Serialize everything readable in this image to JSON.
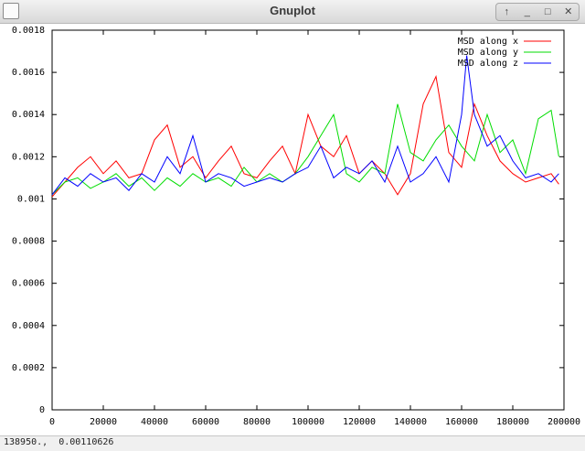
{
  "window": {
    "title": "Gnuplot",
    "buttons": {
      "up": "↑",
      "minimize": "_",
      "maximize": "□",
      "close": "✕"
    }
  },
  "status": {
    "text": "138950.,  0.00110626"
  },
  "chart_data": {
    "type": "line",
    "title": "",
    "xlabel": "",
    "ylabel": "",
    "xlim": [
      0,
      200000
    ],
    "ylim": [
      0,
      0.0018
    ],
    "x_ticks": [
      0,
      20000,
      40000,
      60000,
      80000,
      100000,
      120000,
      140000,
      160000,
      180000,
      200000
    ],
    "y_ticks": [
      0,
      0.0002,
      0.0004,
      0.0006,
      0.0008,
      0.001,
      0.0012,
      0.0014,
      0.0016,
      0.0018
    ],
    "x_tick_labels": [
      "0",
      "20000",
      "40000",
      "60000",
      "80000",
      "100000",
      "120000",
      "140000",
      "160000",
      "180000",
      "200000"
    ],
    "y_tick_labels": [
      "0",
      "0.0002",
      "0.0004",
      "0.0006",
      "0.0008",
      "0.001",
      "0.0012",
      "0.0014",
      "0.0016",
      "0.0018"
    ],
    "grid": false,
    "legend_position": "top-right",
    "series": [
      {
        "name": "MSD along x",
        "color": "#ff0000",
        "x": [
          0,
          5000,
          10000,
          15000,
          20000,
          25000,
          30000,
          35000,
          40000,
          45000,
          50000,
          55000,
          60000,
          65000,
          70000,
          75000,
          80000,
          85000,
          90000,
          95000,
          100000,
          105000,
          110000,
          115000,
          120000,
          125000,
          130000,
          135000,
          140000,
          145000,
          150000,
          155000,
          160000,
          165000,
          170000,
          175000,
          180000,
          185000,
          190000,
          195000,
          198000
        ],
        "y": [
          0.00101,
          0.00108,
          0.00115,
          0.0012,
          0.00112,
          0.00118,
          0.0011,
          0.00112,
          0.00128,
          0.00135,
          0.00115,
          0.0012,
          0.0011,
          0.00118,
          0.00125,
          0.00112,
          0.0011,
          0.00118,
          0.00125,
          0.00112,
          0.0014,
          0.00125,
          0.0012,
          0.0013,
          0.00112,
          0.00118,
          0.00112,
          0.00102,
          0.00112,
          0.00145,
          0.00158,
          0.00122,
          0.00115,
          0.00145,
          0.0013,
          0.00118,
          0.00112,
          0.00108,
          0.0011,
          0.00112,
          0.00107
        ]
      },
      {
        "name": "MSD along y",
        "color": "#00dd00",
        "x": [
          0,
          5000,
          10000,
          15000,
          20000,
          25000,
          30000,
          35000,
          40000,
          45000,
          50000,
          55000,
          60000,
          65000,
          70000,
          75000,
          80000,
          85000,
          90000,
          95000,
          100000,
          105000,
          110000,
          115000,
          120000,
          125000,
          130000,
          135000,
          140000,
          145000,
          150000,
          155000,
          160000,
          165000,
          170000,
          175000,
          180000,
          185000,
          190000,
          195000,
          198000
        ],
        "y": [
          0.00102,
          0.00108,
          0.0011,
          0.00105,
          0.00108,
          0.00112,
          0.00106,
          0.0011,
          0.00104,
          0.0011,
          0.00106,
          0.00112,
          0.00108,
          0.0011,
          0.00106,
          0.00115,
          0.00108,
          0.00112,
          0.00108,
          0.00112,
          0.0012,
          0.0013,
          0.0014,
          0.00112,
          0.00108,
          0.00115,
          0.00112,
          0.00145,
          0.00122,
          0.00118,
          0.00128,
          0.00135,
          0.00125,
          0.00118,
          0.0014,
          0.00122,
          0.00128,
          0.00112,
          0.00138,
          0.00142,
          0.0012
        ]
      },
      {
        "name": "MSD along z",
        "color": "#0000ff",
        "x": [
          0,
          5000,
          10000,
          15000,
          20000,
          25000,
          30000,
          35000,
          40000,
          45000,
          50000,
          55000,
          60000,
          65000,
          70000,
          75000,
          80000,
          85000,
          90000,
          95000,
          100000,
          105000,
          110000,
          115000,
          120000,
          125000,
          130000,
          135000,
          140000,
          145000,
          150000,
          155000,
          160000,
          162000,
          165000,
          170000,
          175000,
          180000,
          185000,
          190000,
          195000,
          198000
        ],
        "y": [
          0.00102,
          0.0011,
          0.00106,
          0.00112,
          0.00108,
          0.0011,
          0.00104,
          0.00112,
          0.00108,
          0.0012,
          0.00112,
          0.0013,
          0.00108,
          0.00112,
          0.0011,
          0.00106,
          0.00108,
          0.0011,
          0.00108,
          0.00112,
          0.00115,
          0.00125,
          0.0011,
          0.00115,
          0.00112,
          0.00118,
          0.00108,
          0.00125,
          0.00108,
          0.00112,
          0.0012,
          0.00108,
          0.0014,
          0.00168,
          0.0014,
          0.00125,
          0.0013,
          0.00118,
          0.0011,
          0.00112,
          0.00108,
          0.00112
        ]
      }
    ]
  }
}
